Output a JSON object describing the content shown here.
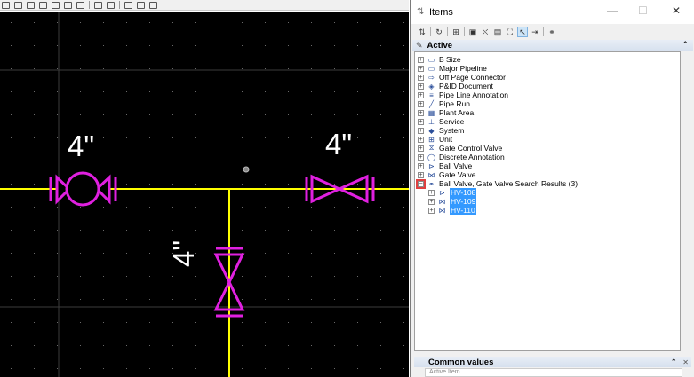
{
  "canvas": {
    "labels": [
      "4\"",
      "4\"",
      "4\""
    ],
    "line_color": "#ffff00",
    "symbol_color": "#e020e0"
  },
  "panel": {
    "title": "Items",
    "minimize": "—",
    "maximize": "☐",
    "close": "✕",
    "active_header": "Active",
    "common_header": "Common values",
    "common_sub": "Active Item"
  },
  "tree": {
    "items": [
      {
        "label": "B Size",
        "icon": "sheet-icon",
        "glyph": "▭"
      },
      {
        "label": "Major Pipeline",
        "icon": "pipeline-icon",
        "glyph": "▭"
      },
      {
        "label": "Off Page Connector",
        "icon": "connector-icon",
        "glyph": "⇨"
      },
      {
        "label": "P&ID Document",
        "icon": "document-icon",
        "glyph": "◈"
      },
      {
        "label": "Pipe Line Annotation",
        "icon": "annotation-icon",
        "glyph": "≡"
      },
      {
        "label": "Pipe Run",
        "icon": "pipe-run-icon",
        "glyph": "╱"
      },
      {
        "label": "Plant Area",
        "icon": "plant-area-icon",
        "glyph": "▦"
      },
      {
        "label": "Service",
        "icon": "service-icon",
        "glyph": "⊥"
      },
      {
        "label": "System",
        "icon": "system-icon",
        "glyph": "◆"
      },
      {
        "label": "Unit",
        "icon": "unit-icon",
        "glyph": "⊞"
      },
      {
        "label": "Gate Control Valve",
        "icon": "control-valve-icon",
        "glyph": "⧖"
      },
      {
        "label": "Discrete Annotation",
        "icon": "discrete-annotation-icon",
        "glyph": "◯"
      },
      {
        "label": "Ball Valve",
        "icon": "ball-valve-icon",
        "glyph": "⊳"
      },
      {
        "label": "Gate Valve",
        "icon": "gate-valve-icon",
        "glyph": "⋈"
      },
      {
        "label": "Ball Valve, Gate Valve Search Results (3)",
        "icon": "binoculars-icon",
        "glyph": "⚭"
      }
    ],
    "children": [
      {
        "label": "HV-108",
        "icon": "ball-valve-icon",
        "glyph": "⊳"
      },
      {
        "label": "HV-109",
        "icon": "gate-valve-icon",
        "glyph": "⋈"
      },
      {
        "label": "HV-110",
        "icon": "gate-valve-icon",
        "glyph": "⋈"
      }
    ]
  },
  "colors": {
    "selection": "#3399ff",
    "canvas_bg": "#000000",
    "highlight_box": "#e04040"
  }
}
